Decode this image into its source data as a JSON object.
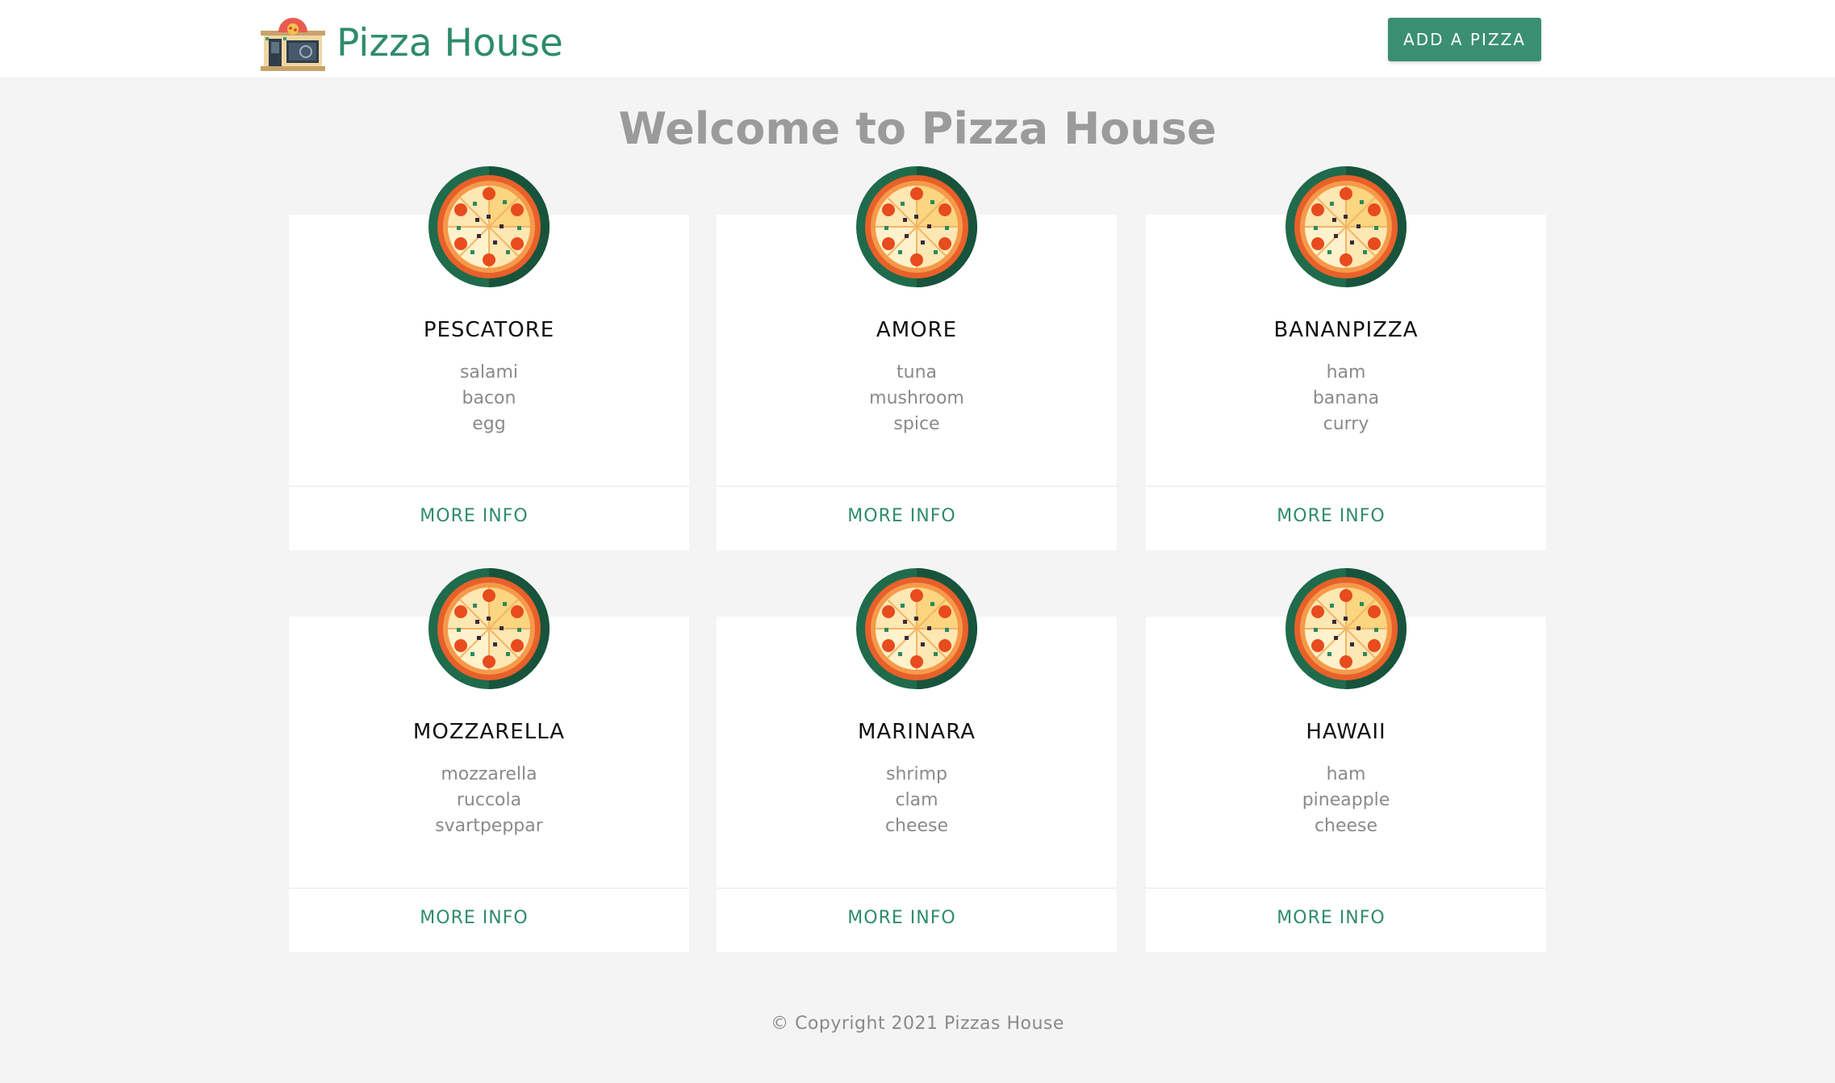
{
  "navbar": {
    "brand_title": "Pizza House",
    "logo_icon": "pizza-shop-icon",
    "add_button_label": "ADD A PIZZA"
  },
  "main": {
    "title": "Welcome to Pizza House",
    "pizzas": [
      {
        "name": "PESCATORE",
        "ingredients": [
          "salami",
          "bacon",
          "egg"
        ],
        "action_label": "MORE INFO",
        "icon": "pizza-icon"
      },
      {
        "name": "AMORE",
        "ingredients": [
          "tuna",
          "mushroom",
          "spice"
        ],
        "action_label": "MORE INFO",
        "icon": "pizza-icon"
      },
      {
        "name": "BANANPIZZA",
        "ingredients": [
          "ham",
          "banana",
          "curry"
        ],
        "action_label": "MORE INFO",
        "icon": "pizza-icon"
      },
      {
        "name": "MOZZARELLA",
        "ingredients": [
          "mozzarella",
          "ruccola",
          "svartpeppar"
        ],
        "action_label": "MORE INFO",
        "icon": "pizza-icon"
      },
      {
        "name": "MARINARA",
        "ingredients": [
          "shrimp",
          "clam",
          "cheese"
        ],
        "action_label": "MORE INFO",
        "icon": "pizza-icon"
      },
      {
        "name": "HAWAII",
        "ingredients": [
          "ham",
          "pineapple",
          "cheese"
        ],
        "action_label": "MORE INFO",
        "icon": "pizza-icon"
      }
    ]
  },
  "footer": {
    "copyright": "© Copyright 2021 Pizzas House"
  },
  "colors": {
    "accent": "#2e8b6e",
    "button": "#3a8f72",
    "background": "#f4f4f4",
    "card": "#ffffff",
    "muted_text": "#8a8a8a"
  }
}
